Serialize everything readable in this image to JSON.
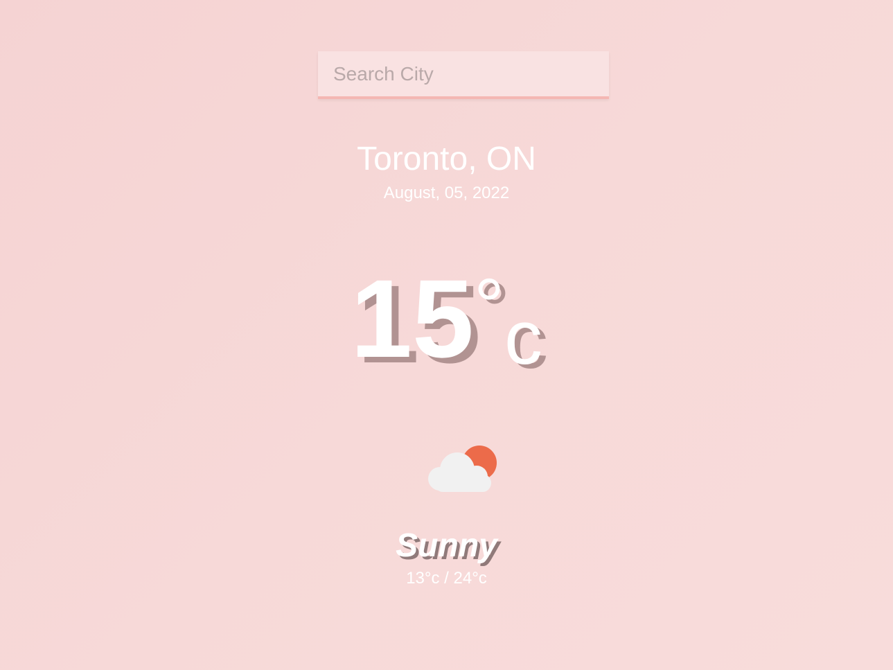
{
  "search": {
    "placeholder": "Search City",
    "value": ""
  },
  "location": {
    "city": "Toronto, ON",
    "date": "August, 05, 2022"
  },
  "current": {
    "temperature": "15",
    "degree_symbol": "°",
    "unit": "c"
  },
  "condition": {
    "icon": "partly-cloudy-icon",
    "label": "Sunny",
    "range": "13°c / 24°c"
  },
  "colors": {
    "background": "#f6d6d5",
    "search_underline": "#f4b7b3",
    "sun": "#ec6b4a",
    "cloud": "#f1f1f1",
    "text": "#ffffff"
  }
}
